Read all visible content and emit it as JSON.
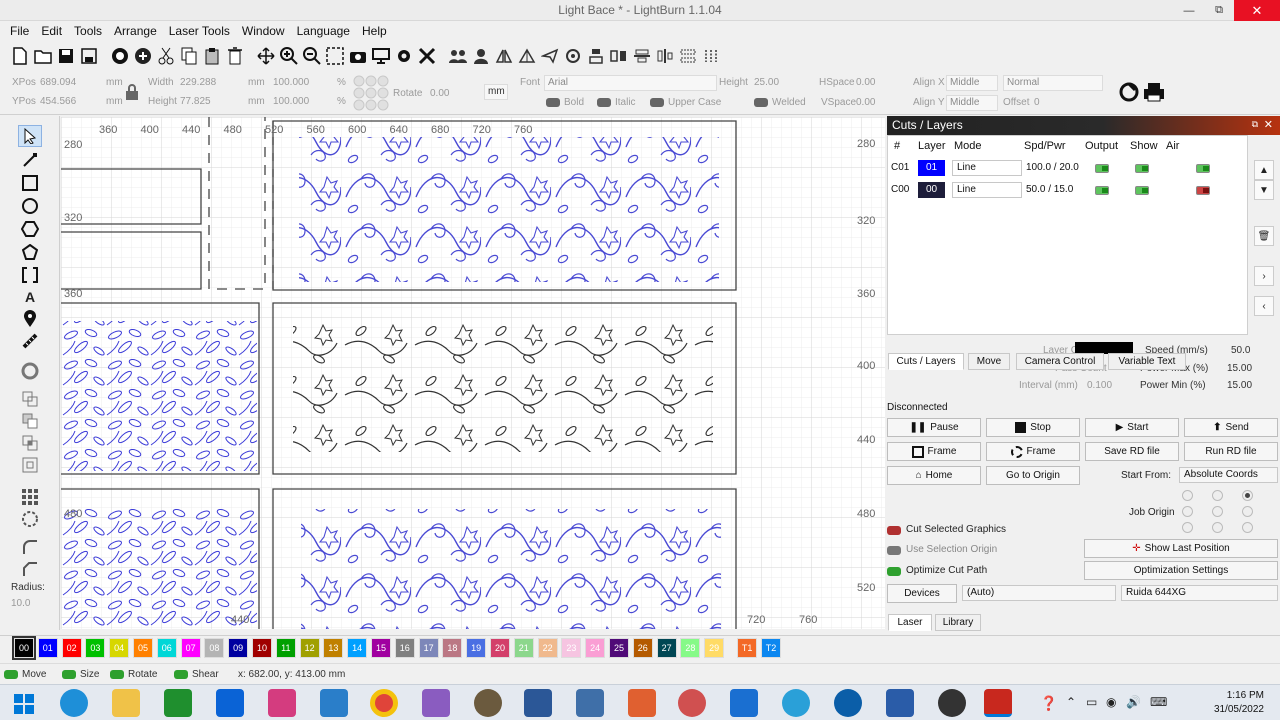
{
  "app": {
    "title": "Light Bace * - LightBurn 1.1.04",
    "win_min": "—",
    "win_max": "⧉",
    "win_close": "✕"
  },
  "menu": [
    "File",
    "Edit",
    "Tools",
    "Arrange",
    "Laser Tools",
    "Window",
    "Language",
    "Help"
  ],
  "props": {
    "xpos_label": "XPos",
    "xpos": "689.094",
    "ypos_label": "YPos",
    "ypos": "454.566",
    "unit": "mm",
    "width_label": "Width",
    "width": "229.288",
    "height_label": "Height",
    "height": "77.825",
    "scale_w": "100.000",
    "scale_h": "100.000",
    "pct": "%",
    "rotate_label": "Rotate",
    "rotate": "0.00",
    "rot_unit": "mm",
    "font_label": "Font",
    "font": "Arial",
    "fheight_label": "Height",
    "fheight": "25.00",
    "hspace_label": "HSpace",
    "hspace": "0.00",
    "vspace_label": "VSpace",
    "vspace": "0.00",
    "alignx_label": "Align X",
    "alignx": "Middle",
    "aligny_label": "Align Y",
    "aligny": "Middle",
    "normal": "Normal",
    "offset_label": "Offset",
    "offset": "0",
    "bold": "Bold",
    "italic": "Italic",
    "upper": "Upper Case",
    "welded": "Welded"
  },
  "rulers": {
    "top": [
      "360",
      "400",
      "440",
      "480",
      "520",
      "560",
      "600",
      "640",
      "680",
      "720",
      "760"
    ],
    "bottom": [
      "440",
      "720",
      "760"
    ],
    "right": [
      "280",
      "320",
      "360",
      "400",
      "440",
      "480",
      "520"
    ],
    "left": [
      "280",
      "320",
      "360",
      "480"
    ]
  },
  "left_tools": {
    "radius_label": "Radius:",
    "radius": "10.0"
  },
  "panel": {
    "title": "Cuts / Layers",
    "headers": {
      "num": "#",
      "layer": "Layer",
      "mode": "Mode",
      "spdpwr": "Spd/Pwr",
      "output": "Output",
      "show": "Show",
      "air": "Air"
    },
    "rows": [
      {
        "num": "C01",
        "layer": "01",
        "mode": "Line",
        "spdpwr": "100.0 / 20.0",
        "color": "#0000ff"
      },
      {
        "num": "C00",
        "layer": "00",
        "mode": "Line",
        "spdpwr": "50.0 / 15.0",
        "color": "#1d1d3a"
      }
    ],
    "layer_color_label": "Layer Color",
    "speed_label": "Speed (mm/s)",
    "speed": "50.0",
    "pass_label": "Pass Count",
    "power_max_label": "Power Max (%)",
    "power_max": "15.00",
    "interval_label": "Interval (mm)",
    "interval": "0.100",
    "power_min_label": "Power Min (%)",
    "power_min": "15.00",
    "tabs": [
      "Cuts / Layers",
      "Move",
      "Camera Control",
      "Variable Text"
    ]
  },
  "laser": {
    "status": "Disconnected",
    "pause": "Pause",
    "stop": "Stop",
    "start": "Start",
    "send": "Send",
    "frame1": "Frame",
    "frame2": "Frame",
    "save_rd": "Save RD file",
    "run_rd": "Run RD file",
    "home": "Home",
    "goto_origin": "Go to Origin",
    "start_from_label": "Start From:",
    "start_from": "Absolute Coords",
    "job_origin_label": "Job Origin",
    "cut_selected": "Cut Selected Graphics",
    "use_selection_origin": "Use Selection Origin",
    "optimize_cut": "Optimize Cut Path",
    "show_last": "Show Last Position",
    "opt_settings": "Optimization Settings",
    "devices": "Devices",
    "auto": "(Auto)",
    "device": "Ruida 644XG",
    "tab_laser": "Laser",
    "tab_library": "Library"
  },
  "palette": [
    {
      "label": "00",
      "color": "#000000"
    },
    {
      "label": "01",
      "color": "#0000ff"
    },
    {
      "label": "02",
      "color": "#ff0000"
    },
    {
      "label": "03",
      "color": "#00c000"
    },
    {
      "label": "04",
      "color": "#d7d700"
    },
    {
      "label": "05",
      "color": "#ff8000"
    },
    {
      "label": "06",
      "color": "#00d7d7"
    },
    {
      "label": "07",
      "color": "#ff00ff"
    },
    {
      "label": "08",
      "color": "#b4b4b4"
    },
    {
      "label": "09",
      "color": "#0000a0"
    },
    {
      "label": "10",
      "color": "#a00000"
    },
    {
      "label": "11",
      "color": "#00a000"
    },
    {
      "label": "12",
      "color": "#a0a000"
    },
    {
      "label": "13",
      "color": "#c08000"
    },
    {
      "label": "14",
      "color": "#00a0ff"
    },
    {
      "label": "15",
      "color": "#a000a0"
    },
    {
      "label": "16",
      "color": "#808080"
    },
    {
      "label": "17",
      "color": "#7d87b9"
    },
    {
      "label": "18",
      "color": "#bb7784"
    },
    {
      "label": "19",
      "color": "#4a6fe3"
    },
    {
      "label": "20",
      "color": "#d33f6a"
    },
    {
      "label": "21",
      "color": "#8cd78c"
    },
    {
      "label": "22",
      "color": "#f0b98d"
    },
    {
      "label": "23",
      "color": "#f6c4e1"
    },
    {
      "label": "24",
      "color": "#fa9ed4"
    },
    {
      "label": "25",
      "color": "#500a78"
    },
    {
      "label": "26",
      "color": "#b45a00"
    },
    {
      "label": "27",
      "color": "#004754"
    },
    {
      "label": "28",
      "color": "#86fa88"
    },
    {
      "label": "29",
      "color": "#ffdb66"
    },
    {
      "label": "T1",
      "color": "#f36926"
    },
    {
      "label": "T2",
      "color": "#0c87f0"
    }
  ],
  "status": {
    "move": "Move",
    "size": "Size",
    "rotate": "Rotate",
    "shear": "Shear",
    "coords": "x: 682.00, y: 413.00 mm"
  },
  "taskbar": {
    "time": "1:16 PM",
    "date": "31/05/2022"
  }
}
